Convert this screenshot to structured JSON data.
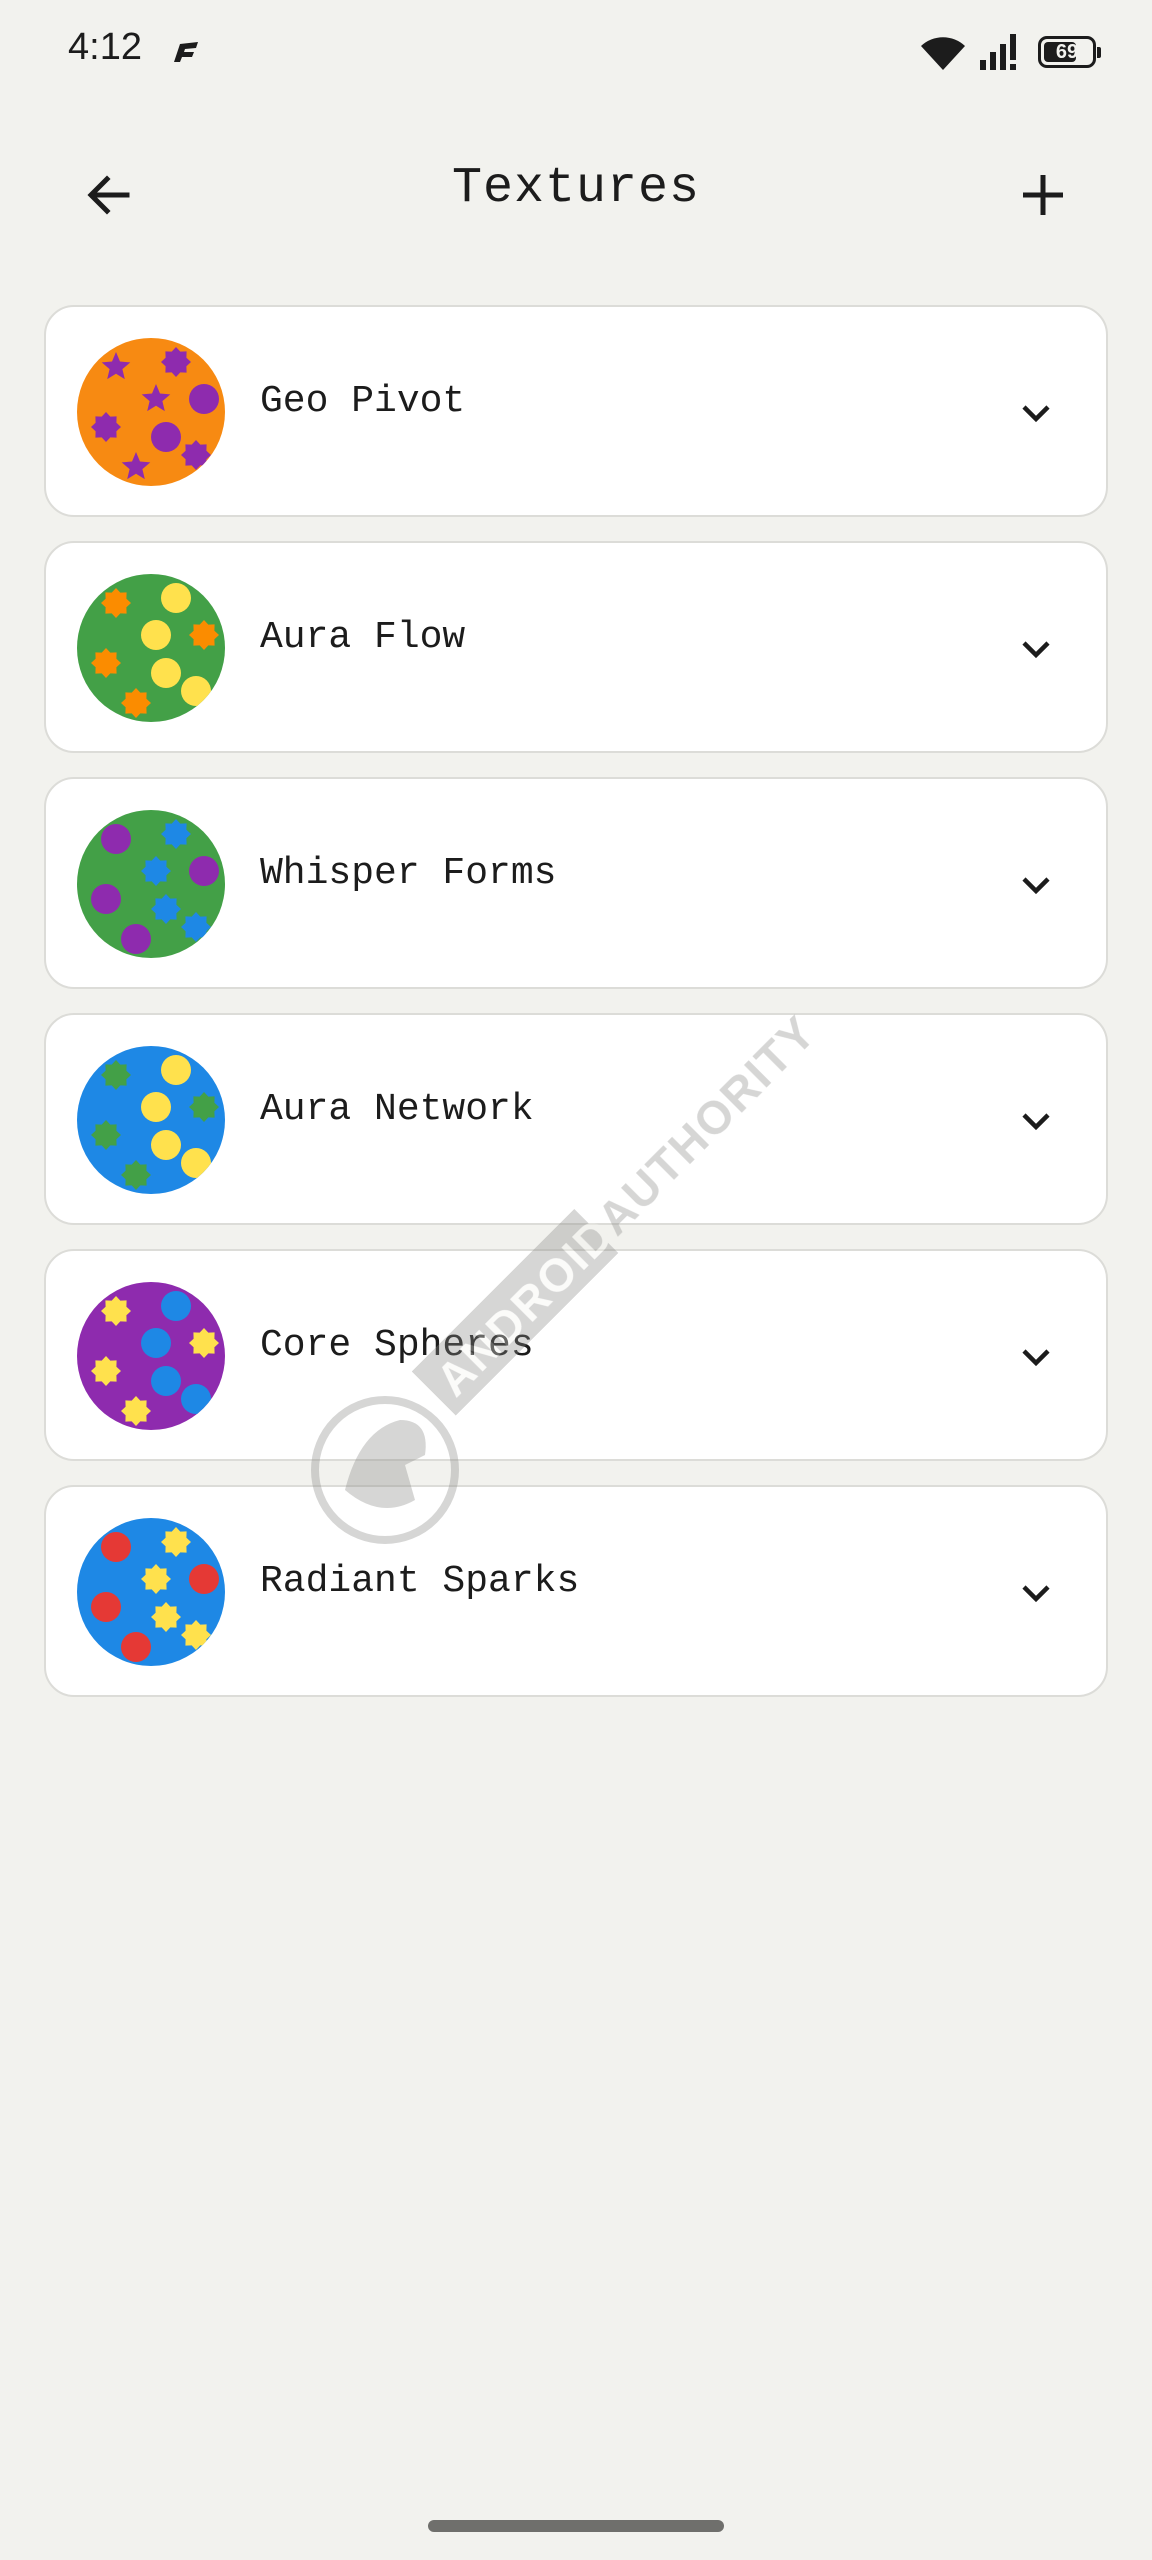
{
  "status_bar": {
    "time": "4:12",
    "battery": "69",
    "battery_level_percent": 69,
    "icons": [
      "app-notification-icon",
      "wifi-icon",
      "signal-icon",
      "battery-icon"
    ]
  },
  "header": {
    "title": "Textures",
    "back_icon": "arrow-left-icon",
    "add_icon": "plus-icon"
  },
  "textures": [
    {
      "name": "Geo Pivot",
      "base_color": "#F78A12",
      "pattern_colors": [
        "#8E2BAE"
      ]
    },
    {
      "name": "Aura Flow",
      "base_color": "#43A047",
      "pattern_colors": [
        "#FB8C00",
        "#FFE14D"
      ]
    },
    {
      "name": "Whisper Forms",
      "base_color": "#43A047",
      "pattern_colors": [
        "#8E2BAE",
        "#1E88E5"
      ]
    },
    {
      "name": "Aura Network",
      "base_color": "#1E88E5",
      "pattern_colors": [
        "#43A047",
        "#FFE14D"
      ]
    },
    {
      "name": "Core Spheres",
      "base_color": "#8E2BAE",
      "pattern_colors": [
        "#FFE14D",
        "#1E88E5"
      ]
    },
    {
      "name": "Radiant Sparks",
      "base_color": "#1E88E5",
      "pattern_colors": [
        "#E53935",
        "#FFE14D"
      ]
    }
  ],
  "watermark": {
    "text": "ANDROID AUTHORITY"
  }
}
